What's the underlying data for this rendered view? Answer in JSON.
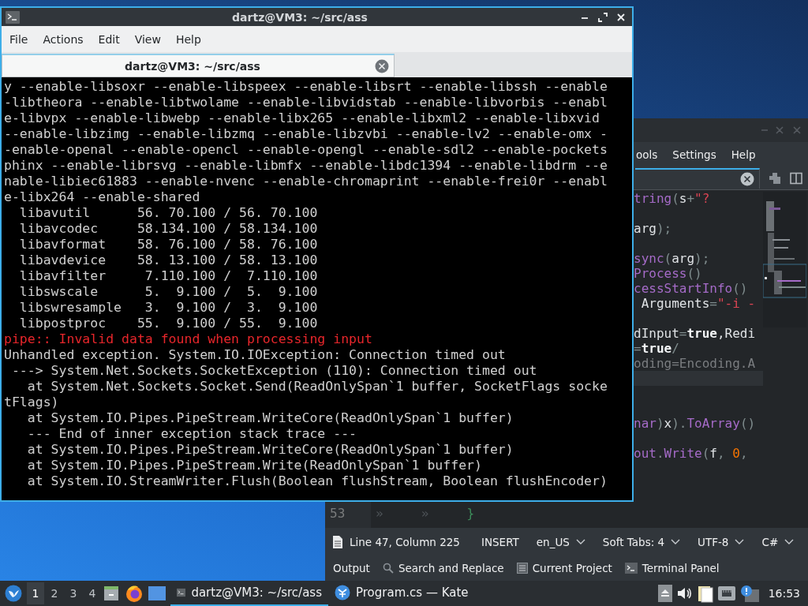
{
  "terminal": {
    "title": "dartz@VM3: ~/src/ass",
    "menu": [
      "File",
      "Actions",
      "Edit",
      "View",
      "Help"
    ],
    "tabs": [
      {
        "title": "dartz@VM3: ~/src/ass",
        "selected": true
      }
    ],
    "lines": [
      {
        "text": "y --enable-libsoxr --enable-libspeex --enable-libsrt --enable-libssh --enable",
        "kind": "normal"
      },
      {
        "text": "-libtheora --enable-libtwolame --enable-libvidstab --enable-libvorbis --enabl",
        "kind": "normal"
      },
      {
        "text": "e-libvpx --enable-libwebp --enable-libx265 --enable-libxml2 --enable-libxvid",
        "kind": "normal"
      },
      {
        "text": "--enable-libzimg --enable-libzmq --enable-libzvbi --enable-lv2 --enable-omx -",
        "kind": "normal"
      },
      {
        "text": "-enable-openal --enable-opencl --enable-opengl --enable-sdl2 --enable-pockets",
        "kind": "normal"
      },
      {
        "text": "phinx --enable-librsvg --enable-libmfx --enable-libdc1394 --enable-libdrm --e",
        "kind": "normal"
      },
      {
        "text": "nable-libiec61883 --enable-nvenc --enable-chromaprint --enable-frei0r --enabl",
        "kind": "normal"
      },
      {
        "text": "e-libx264 --enable-shared",
        "kind": "normal"
      },
      {
        "text": "  libavutil      56. 70.100 / 56. 70.100",
        "kind": "normal"
      },
      {
        "text": "  libavcodec     58.134.100 / 58.134.100",
        "kind": "normal"
      },
      {
        "text": "  libavformat    58. 76.100 / 58. 76.100",
        "kind": "normal"
      },
      {
        "text": "  libavdevice    58. 13.100 / 58. 13.100",
        "kind": "normal"
      },
      {
        "text": "  libavfilter     7.110.100 /  7.110.100",
        "kind": "normal"
      },
      {
        "text": "  libswscale      5.  9.100 /  5.  9.100",
        "kind": "normal"
      },
      {
        "text": "  libswresample   3.  9.100 /  3.  9.100",
        "kind": "normal"
      },
      {
        "text": "  libpostproc    55.  9.100 / 55.  9.100",
        "kind": "normal"
      },
      {
        "text": "pipe:: Invalid data found when processing input",
        "kind": "error"
      },
      {
        "text": "Unhandled exception. System.IO.IOException: Connection timed out",
        "kind": "normal"
      },
      {
        "text": " ---> System.Net.Sockets.SocketException (110): Connection timed out",
        "kind": "normal"
      },
      {
        "text": "   at System.Net.Sockets.Socket.Send(ReadOnlySpan`1 buffer, SocketFlags socke",
        "kind": "normal"
      },
      {
        "text": "tFlags)",
        "kind": "normal"
      },
      {
        "text": "   at System.IO.Pipes.PipeStream.WriteCore(ReadOnlySpan`1 buffer)",
        "kind": "normal"
      },
      {
        "text": "   --- End of inner exception stack trace ---",
        "kind": "normal"
      },
      {
        "text": "   at System.IO.Pipes.PipeStream.WriteCore(ReadOnlySpan`1 buffer)",
        "kind": "normal"
      },
      {
        "text": "   at System.IO.Pipes.PipeStream.Write(ReadOnlySpan`1 buffer)",
        "kind": "normal"
      },
      {
        "text": "   at System.IO.StreamWriter.Flush(Boolean flushStream, Boolean flushEncoder)",
        "kind": "normal"
      }
    ]
  },
  "editor": {
    "menu": [
      "ools",
      "Settings",
      "Help"
    ],
    "code_lines": [
      {
        "current": false,
        "segments": [
          {
            "text": "tring",
            "kind": "fn"
          },
          {
            "text": "(",
            "kind": "op"
          },
          {
            "text": "s",
            "kind": "id"
          },
          {
            "text": "+",
            "kind": "op"
          },
          {
            "text": "\"?",
            "kind": "str"
          }
        ]
      },
      {
        "current": false
      },
      {
        "current": false,
        "segments": [
          {
            "text": "arg",
            "kind": "id"
          },
          {
            "text": ");",
            "kind": "op"
          }
        ]
      },
      {
        "current": false
      },
      {
        "current": false,
        "segments": [
          {
            "text": "sync",
            "kind": "fn"
          },
          {
            "text": "(",
            "kind": "op"
          },
          {
            "text": "arg",
            "kind": "id"
          },
          {
            "text": ");",
            "kind": "op"
          }
        ]
      },
      {
        "current": false,
        "segments": [
          {
            "text": "Process",
            "kind": "fn"
          },
          {
            "text": "()",
            "kind": "op"
          }
        ]
      },
      {
        "current": false,
        "segments": [
          {
            "text": "cessStartInfo",
            "kind": "fn"
          },
          {
            "text": "()",
            "kind": "op"
          }
        ]
      },
      {
        "current": false,
        "segments": [
          {
            "text": " Arguments",
            "kind": "id"
          },
          {
            "text": "=",
            "kind": "op"
          },
          {
            "text": "\"-i -",
            "kind": "str"
          }
        ]
      },
      {
        "current": false
      },
      {
        "current": false,
        "segments": [
          {
            "text": "dInput",
            "kind": "id"
          },
          {
            "text": "=",
            "kind": "op"
          },
          {
            "text": "true",
            "kind": "kw"
          },
          {
            "text": ",Redi",
            "kind": "id"
          }
        ]
      },
      {
        "current": false,
        "segments": [
          {
            "text": "=",
            "kind": "op"
          },
          {
            "text": "true",
            "kind": "kw"
          },
          {
            "text": "/",
            "kind": "op"
          }
        ]
      },
      {
        "current": false,
        "segments": [
          {
            "text": "oding=Encoding.A",
            "kind": "dim"
          }
        ]
      },
      {
        "current": true
      },
      {
        "current": false
      },
      {
        "current": false
      },
      {
        "current": false,
        "segments": [
          {
            "text": "nar",
            "kind": "fn"
          },
          {
            "text": ")",
            "kind": "op"
          },
          {
            "text": "x",
            "kind": "id"
          },
          {
            "text": ").",
            "kind": "op"
          },
          {
            "text": "ToArray",
            "kind": "fn"
          },
          {
            "text": "()",
            "kind": "op"
          }
        ]
      },
      {
        "current": false
      },
      {
        "current": false,
        "segments": [
          {
            "text": "out",
            "kind": "fn"
          },
          {
            "text": ".",
            "kind": "op"
          },
          {
            "text": "Write",
            "kind": "fn"
          },
          {
            "text": "(",
            "kind": "op"
          },
          {
            "text": "f",
            "kind": "id"
          },
          {
            "text": ", ",
            "kind": "op"
          },
          {
            "text": "0",
            "kind": "num"
          },
          {
            "text": ",",
            "kind": "op"
          }
        ]
      },
      {
        "current": false
      },
      {
        "current": false
      },
      {
        "current": false
      },
      {
        "current": false,
        "number": "53",
        "segments": [
          {
            "text": "»     »     ",
            "kind": "tab"
          },
          {
            "text": "}",
            "kind": "brace"
          }
        ]
      }
    ],
    "status_bar": {
      "position": "Line 47, Column 225",
      "mode": "INSERT",
      "dropdowns": [
        "en_US",
        "Soft Tabs: 4",
        "UTF-8",
        "C#"
      ]
    },
    "tool_views": [
      {
        "label": "Output",
        "kind": "plain"
      },
      {
        "label": "Search and Replace",
        "kind": "search"
      },
      {
        "label": "Current Project",
        "kind": "project"
      },
      {
        "label": "Terminal Panel",
        "kind": "terminal"
      }
    ]
  },
  "taskbar": {
    "workspaces": [
      {
        "label": "1",
        "selected": true
      },
      {
        "label": "2",
        "selected": false
      },
      {
        "label": "3",
        "selected": false
      },
      {
        "label": "4",
        "selected": false
      }
    ],
    "tasks": [
      {
        "title": "dartz@VM3: ~/src/ass",
        "kind": "terminal",
        "selected": true
      },
      {
        "title": "Program.cs — Kate",
        "kind": "kate",
        "selected": false
      }
    ],
    "clock": "16:53"
  }
}
